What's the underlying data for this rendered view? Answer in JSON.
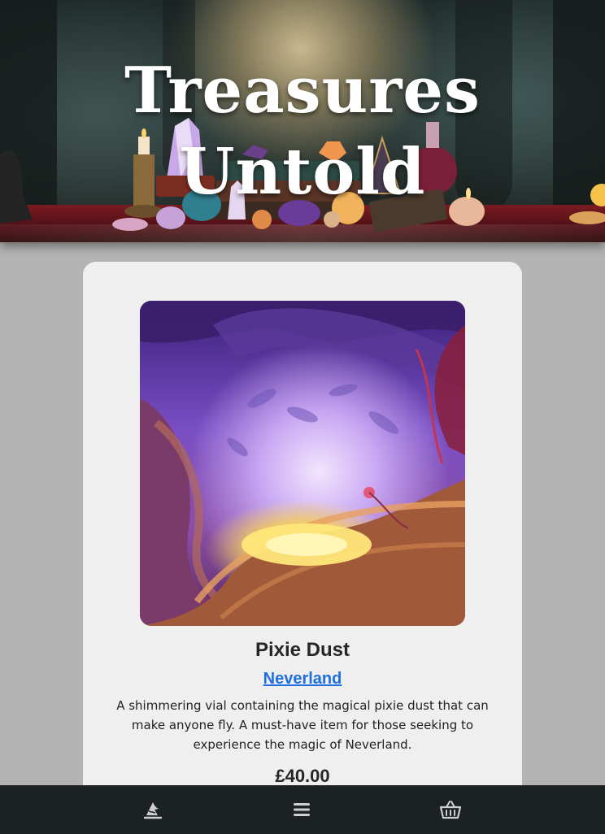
{
  "banner": {
    "title": "Treasures Untold"
  },
  "product": {
    "name": "Pixie Dust",
    "realm_link": "Neverland",
    "description": "A shimmering vial containing the magical pixie dust that can make anyone fly. A must-have item for those seeking to experience the magic of Neverland.",
    "price": "£40.00"
  },
  "nav": {
    "items": [
      {
        "icon": "wizard-hat-icon"
      },
      {
        "icon": "menu-icon"
      },
      {
        "icon": "basket-icon"
      }
    ]
  },
  "colors": {
    "page_background": "#b3b3b3",
    "card_background": "#efefef",
    "nav_background": "#1c2123",
    "link": "#1f6fe0",
    "icon": "#cfcfcf"
  }
}
